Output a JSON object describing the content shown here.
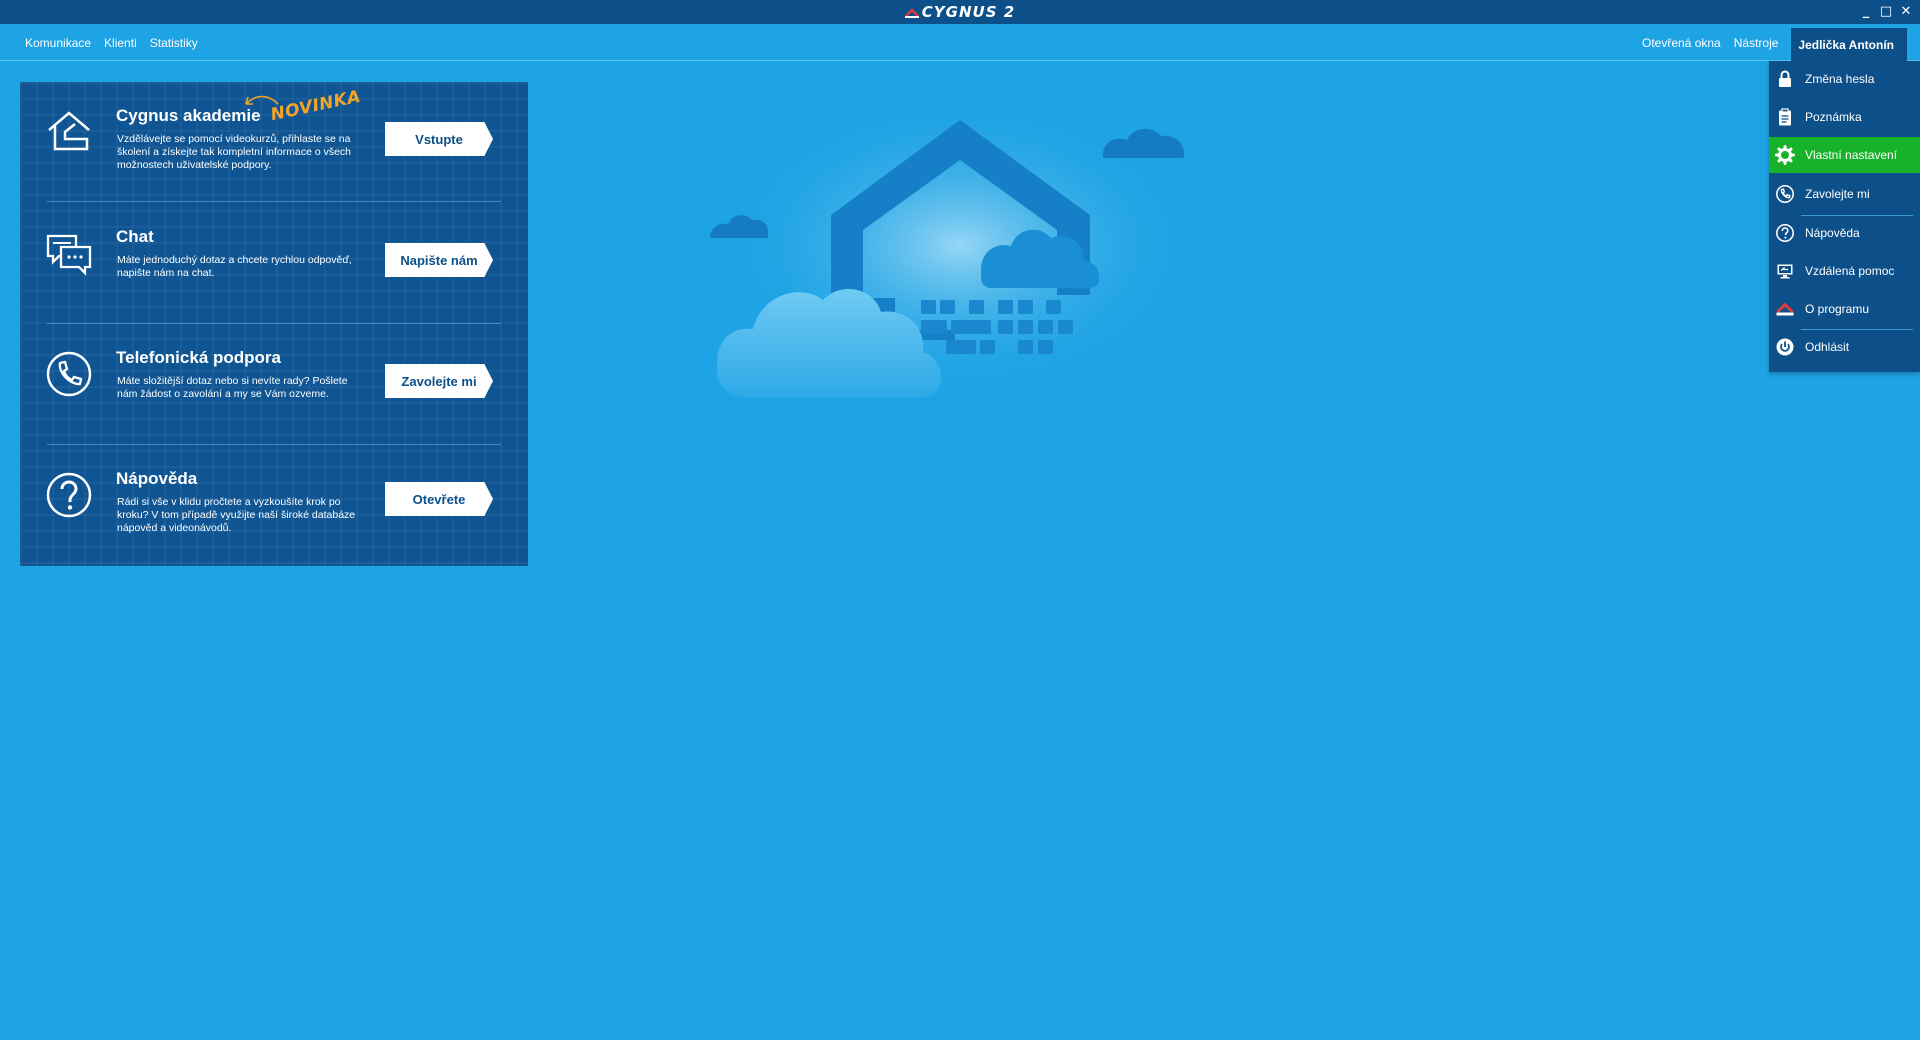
{
  "titlebar": {
    "app_name": "CYGNUS 2",
    "minimize": "_",
    "maximize": "□",
    "close": "✕"
  },
  "menubar": {
    "left": [
      "Komunikace",
      "Klienti",
      "Statistiky"
    ],
    "right": [
      "Otevřená okna",
      "Nástroje"
    ],
    "user": "Jedlička Antonín"
  },
  "panel": {
    "badge_new": "NOVINKA",
    "sections": [
      {
        "icon": "house-icon",
        "title": "Cygnus akademie",
        "desc": "Vzdělávejte se pomocí videokurzů, přihlaste se na školení a získejte tak kompletní informace o všech možnostech uživatelské podpory.",
        "button": "Vstupte"
      },
      {
        "icon": "chat-icon",
        "title": "Chat",
        "desc": "Máte jednoduchý dotaz a chcete rychlou odpověď, napište nám na chat.",
        "button": "Napište nám"
      },
      {
        "icon": "phone-icon",
        "title": "Telefonická podpora",
        "desc": "Máte složitější dotaz nebo si nevíte rady? Pošlete nám žádost o zavolání a my se Vám ozveme.",
        "button": "Zavolejte mi"
      },
      {
        "icon": "help-icon",
        "title": "Nápověda",
        "desc": "Rádi si vše v klidu pročtete a vyzkoušíte krok po kroku? V tom případě využijte naší široké databáze nápověd a videonávodů.",
        "button": "Otevřete"
      }
    ]
  },
  "dropdown": {
    "items": [
      {
        "label": "Změna hesla",
        "icon": "lock-icon"
      },
      {
        "label": "Poznámka",
        "icon": "clipboard-icon"
      },
      {
        "label": "Vlastní nastavení",
        "icon": "gear-icon",
        "active": true
      },
      {
        "label": "Zavolejte mi",
        "icon": "phone-icon"
      },
      {
        "label": "Nápověda",
        "icon": "help-icon"
      },
      {
        "label": "Vzdálená pomoc",
        "icon": "remote-screen-icon"
      },
      {
        "label": "O programu",
        "icon": "app-logo-icon"
      },
      {
        "label": "Odhlásit",
        "icon": "power-icon"
      }
    ]
  },
  "colors": {
    "background": "#1ea3e4",
    "titlebar": "#0d4f88",
    "panel": "#0f5593",
    "accent_active": "#18b12a",
    "badge": "#f2a527"
  }
}
